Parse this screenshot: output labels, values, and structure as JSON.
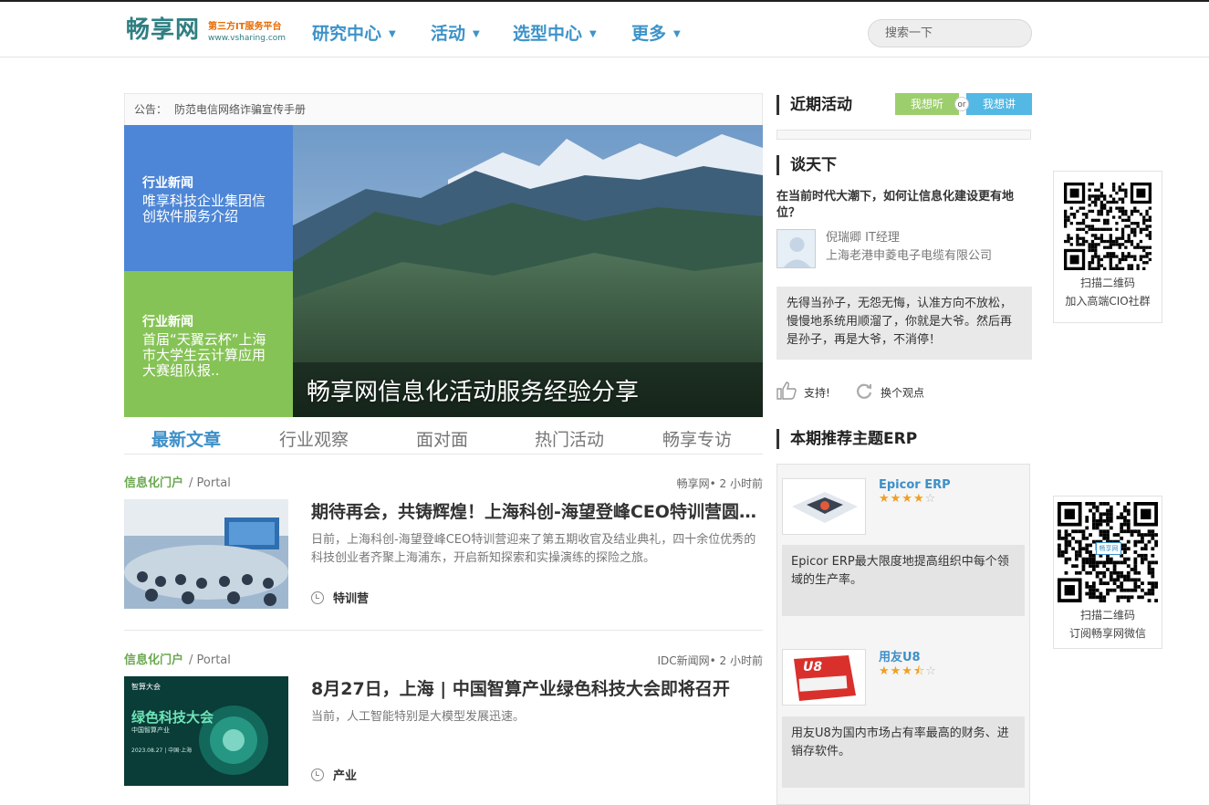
{
  "header": {
    "logo": {
      "main": "畅享网",
      "sub_tagline": "第三方IT服务平台",
      "sub_url": "www.vsharing.com"
    },
    "nav": [
      "研究中心",
      "活动",
      "选型中心",
      "更多"
    ],
    "search": {
      "placeholder": "搜索一下"
    }
  },
  "notice": {
    "label": "公告：",
    "text": "防范电信网络诈骗宣传手册"
  },
  "slider": {
    "tiles": [
      {
        "category": "行业新闻",
        "title": "唯享科技企业集团信创软件服务介绍"
      },
      {
        "category": "行业新闻",
        "title": "首届“天翼云杯”上海市大学生云计算应用大赛组队报.."
      }
    ],
    "hero_caption": "畅享网信息化活动服务经验分享"
  },
  "tabs": [
    "最新文章",
    "行业观察",
    "面对面",
    "热门活动",
    "畅享专访"
  ],
  "articles": [
    {
      "category": "信息化门户",
      "subcategory": "/ Portal",
      "source": "畅享网• 2 小时前",
      "title": "期待再会，共铸辉煌！上海科创-海望登峰CEO特训营圆满结业",
      "summary": "日前，上海科创-海望登峰CEO特训营迎来了第五期收官及结业典礼，四十余位优秀的科技创业者齐聚上海浦东，开启新知探索和实操演练的探险之旅。",
      "tag": "特训营"
    },
    {
      "category": "信息化门户",
      "subcategory": "/ Portal",
      "source": "IDC新闻网• 2 小时前",
      "title": "8月27日，上海 | 中国智算产业绿色科技大会即将召开",
      "summary": "当前，人工智能特别是大模型发展迅速。",
      "tag": "产业",
      "thumb_text": {
        "brand": "智算大会",
        "headline": "绿色科技大会",
        "sub": "中国智算产业",
        "date": "2023.08.27 | 中国·上海"
      }
    }
  ],
  "sidebar": {
    "recent": {
      "title": "近期活动",
      "btn_listen": "我想听",
      "btn_or": "or",
      "btn_speak": "我想讲"
    },
    "talk": {
      "title": "谈天下",
      "question": "在当前时代大潮下，如何让信息化建设更有地位？",
      "author": "倪瑞卿 IT经理",
      "company": "上海老港申菱电子电缆有限公司",
      "quote": "先得当孙子，无怨无悔，认准方向不放松，慢慢地系统用顺溜了，你就是大爷。然后再是孙子，再是大爷，不消停！",
      "support": "支持!",
      "change": "换个观点"
    },
    "erp": {
      "title": "本期推荐主题ERP",
      "items": [
        {
          "name": "Epicor ERP",
          "rating": 3.5,
          "stars_on": "★★★★",
          "stars_off": "☆",
          "desc": "Epicor ERP最大限度地提高组织中每个领域的生产率。"
        },
        {
          "name": "用友U8",
          "rating": 3.5,
          "stars_on": "★★★",
          "stars_half": "⯪",
          "stars_off": "☆",
          "desc": "用友U8为国内市场占有率最高的财务、进销存软件。",
          "logo_text": "U8"
        }
      ]
    }
  },
  "qr": [
    {
      "line1": "扫描二维码",
      "line2": "加入高端CIO社群"
    },
    {
      "line1": "扫描二维码",
      "line2": "订阅畅享网微信",
      "badge": "畅享网"
    }
  ],
  "colors": {
    "nav_blue": "#3d93c9",
    "tile_blue": "#4d86d6",
    "tile_green": "#86c356",
    "category_green": "#6aa84f",
    "listen_green": "#9dce6d",
    "speak_blue": "#53b8e4"
  }
}
